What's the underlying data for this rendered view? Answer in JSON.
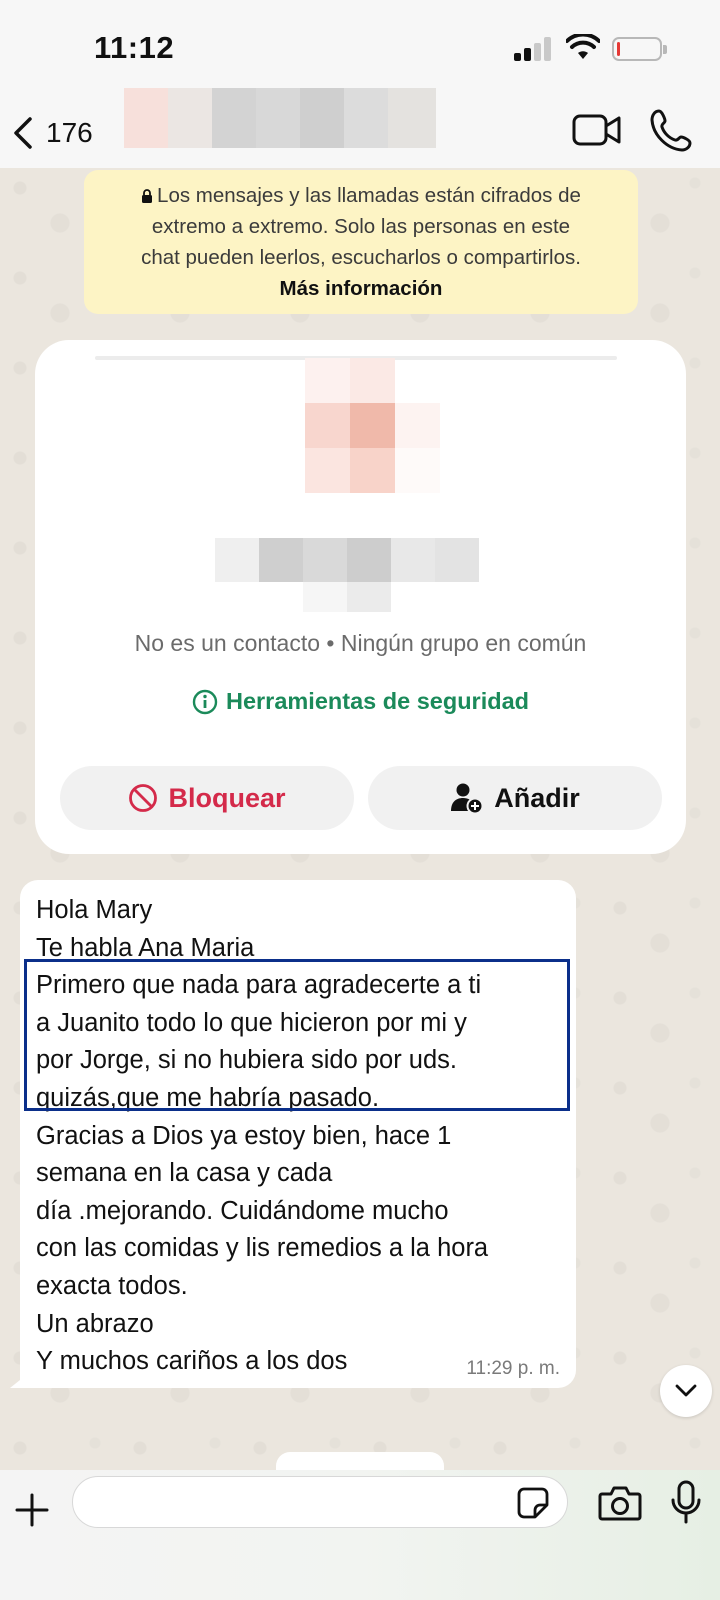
{
  "status_bar": {
    "time": "11:12"
  },
  "header": {
    "back_count": "176"
  },
  "encryption_notice": {
    "line1": "Los mensajes y las llamadas están cifrados de",
    "line2": "extremo a extremo. Solo las personas en este",
    "line3": "chat pueden leerlos, escucharlos o compartirlos.",
    "more_info": "Más información"
  },
  "contact_card": {
    "info": "No es un contacto • Ningún grupo en común",
    "safety_tools": "Herramientas de seguridad",
    "block_label": "Bloquear",
    "add_label": "Añadir"
  },
  "message": {
    "lines": [
      "Hola Mary",
      "Te habla Ana Maria",
      "Primero que nada para agradecerte a ti",
      "a Juanito todo lo que hicieron por mi y",
      "por Jorge, si no hubiera sido por uds.",
      "quizás,que me habría pasado.",
      "Gracias a Dios ya estoy bien, hace 1",
      "semana en la casa y cada",
      "día .mejorando. Cuidándome mucho",
      "con las comidas y lis remedios a la hora",
      "exacta todos.",
      "Un abrazo",
      "Y muchos cariños a los dos"
    ],
    "time": "11:29 p. m."
  },
  "input": {
    "value": "",
    "placeholder": ""
  },
  "colors": {
    "accent_green": "#1b8a5a",
    "block_red": "#d42a4a",
    "highlight_border": "#0b2f8a",
    "notice_bg": "#fdf4c5"
  }
}
